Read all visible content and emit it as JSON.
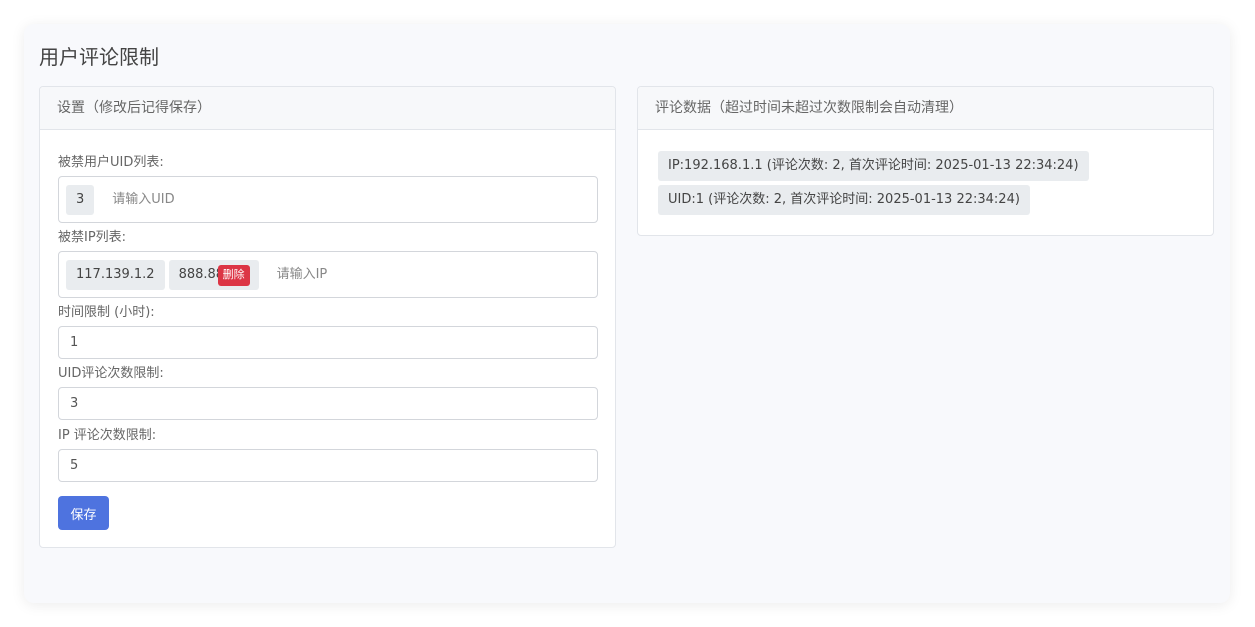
{
  "page": {
    "title": "用户评论限制"
  },
  "settings": {
    "header": "设置（修改后记得保存）",
    "uid_list_label": "被禁用户UID列表:",
    "uid_tags": [
      "3"
    ],
    "uid_placeholder": "请输入UID",
    "ip_list_label": "被禁IP列表:",
    "ip_tags": [
      "117.139.1.2",
      "888.88"
    ],
    "delete_label": "删除",
    "ip_placeholder": "请输入IP",
    "time_limit_label": "时间限制 (小时):",
    "time_limit_value": "1",
    "uid_limit_label": "UID评论次数限制:",
    "uid_limit_value": "3",
    "ip_limit_label": "IP 评论次数限制:",
    "ip_limit_value": "5",
    "save_label": "保存"
  },
  "comments": {
    "header": "评论数据（超过时间未超过次数限制会自动清理）",
    "items": [
      "IP:192.168.1.1 (评论次数: 2, 首次评论时间: 2025-01-13 22:34:24)",
      "UID:1 (评论次数: 2, 首次评论时间: 2025-01-13 22:34:24)"
    ]
  },
  "colors": {
    "primary": "#4e73df",
    "danger": "#dc3545",
    "tag_bg": "#e9ecef"
  }
}
